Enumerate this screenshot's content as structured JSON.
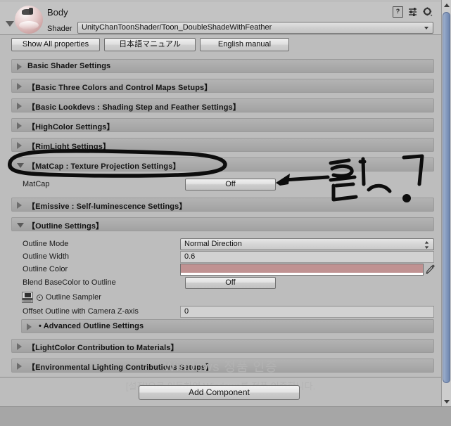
{
  "material": {
    "name": "Body",
    "shader_label": "Shader",
    "shader_value": "UnityChanToonShader/Toon_DoubleShadeWithFeather",
    "help_icon": "help-icon",
    "preset_icon": "preset-icon",
    "gear_icon": "gear-icon"
  },
  "toolbar": {
    "show_all_properties": "Show All properties",
    "japanese_manual": "日本語マニュアル",
    "english_manual": "English manual"
  },
  "sections": [
    {
      "title": "Basic Shader Settings",
      "open": false
    },
    {
      "title": "【Basic Three Colors and Control Maps Setups】",
      "open": false
    },
    {
      "title": "【Basic Lookdevs : Shading Step and Feather Settings】",
      "open": false
    },
    {
      "title": "【HighColor Settings】",
      "open": false
    },
    {
      "title": "【RimLight Settings】",
      "open": false
    },
    {
      "title": "【MatCap : Texture Projection Settings】",
      "open": true
    },
    {
      "title": "【Emissive : Self-luminescence Settings】",
      "open": false
    },
    {
      "title": "【Outline Settings】",
      "open": true
    },
    {
      "title": "• Advanced Outline Settings",
      "open": false
    },
    {
      "title": "【LightColor Contribution to Materials】",
      "open": false
    },
    {
      "title": "【Environmental Lighting Contributions Setups】",
      "open": false
    }
  ],
  "matcap": {
    "label": "MatCap",
    "value": "Off"
  },
  "outline": {
    "mode_label": "Outline Mode",
    "mode_value": "Normal Direction",
    "width_label": "Outline Width",
    "width_value": "0.6",
    "color_label": "Outline Color",
    "color_value": "#c09292",
    "eyedropper_icon": "eyedropper-icon",
    "blend_label": "Blend BaseColor to Outline",
    "blend_value": "Off",
    "sampler_label": "Outline Sampler",
    "sampler_thumb_icon": "texture-thumbnail-icon",
    "sampler_radio_icon": "object-select-icon",
    "offset_label": "Offset Outline with Camera Z-axis",
    "offset_value": "0"
  },
  "footer": {
    "add_component": "Add Component"
  },
  "watermark": {
    "line1": "Windows 정품 인증",
    "line2": "[설정]으로 이동하여 Windows를 정품 인증합니다."
  },
  "annotation": {
    "handwriting_text": "활성화?",
    "description": "hand-drawn black marker ellipse around MatCap section header with arrow pointing at MatCap Off toggle"
  },
  "scrollbar": {
    "up_icon": "scroll-up-icon",
    "down_icon": "scroll-down-icon"
  }
}
